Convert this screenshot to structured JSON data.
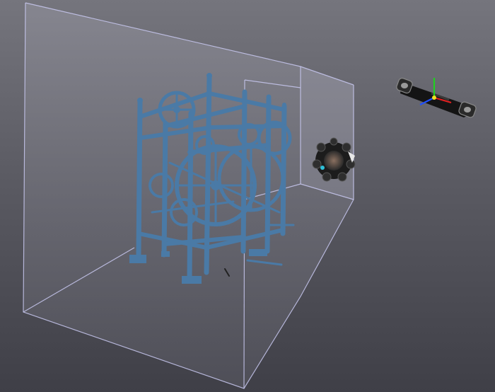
{
  "viewport": {
    "scene_objects": [
      {
        "name": "clock-mechanism-model",
        "color": "#4a7aa6"
      },
      {
        "name": "optical-scanner-head",
        "color": "#1c1c1c"
      },
      {
        "name": "handheld-scanner-bar",
        "color": "#141414"
      }
    ],
    "colors": {
      "background_top": "#75757d",
      "background_bottom": "#3f3f47",
      "bounding_box_edge": "#c8c8f0",
      "model_blue": "#4a7aa6",
      "axis_x": "#e02020",
      "axis_y": "#20d020",
      "axis_z": "#2050ff"
    },
    "icons": [
      "xyz-axis-gizmo-icon"
    ]
  }
}
